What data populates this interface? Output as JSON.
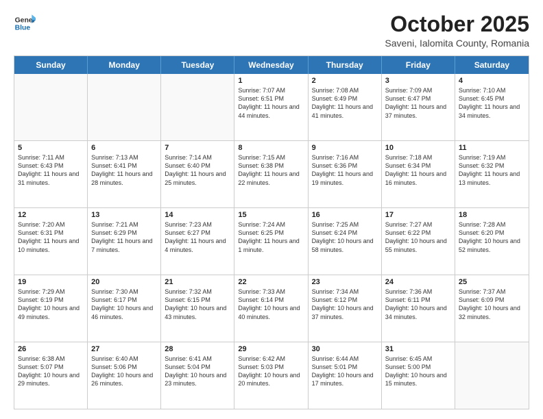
{
  "header": {
    "logo_line1": "General",
    "logo_line2": "Blue",
    "title": "October 2025",
    "subtitle": "Saveni, Ialomita County, Romania"
  },
  "calendar": {
    "days_of_week": [
      "Sunday",
      "Monday",
      "Tuesday",
      "Wednesday",
      "Thursday",
      "Friday",
      "Saturday"
    ],
    "rows": [
      [
        {
          "day": "",
          "empty": true
        },
        {
          "day": "",
          "empty": true
        },
        {
          "day": "",
          "empty": true
        },
        {
          "day": "1",
          "sunrise": "7:07 AM",
          "sunset": "6:51 PM",
          "daylight": "11 hours and 44 minutes."
        },
        {
          "day": "2",
          "sunrise": "7:08 AM",
          "sunset": "6:49 PM",
          "daylight": "11 hours and 41 minutes."
        },
        {
          "day": "3",
          "sunrise": "7:09 AM",
          "sunset": "6:47 PM",
          "daylight": "11 hours and 37 minutes."
        },
        {
          "day": "4",
          "sunrise": "7:10 AM",
          "sunset": "6:45 PM",
          "daylight": "11 hours and 34 minutes."
        }
      ],
      [
        {
          "day": "5",
          "sunrise": "7:11 AM",
          "sunset": "6:43 PM",
          "daylight": "11 hours and 31 minutes."
        },
        {
          "day": "6",
          "sunrise": "7:13 AM",
          "sunset": "6:41 PM",
          "daylight": "11 hours and 28 minutes."
        },
        {
          "day": "7",
          "sunrise": "7:14 AM",
          "sunset": "6:40 PM",
          "daylight": "11 hours and 25 minutes."
        },
        {
          "day": "8",
          "sunrise": "7:15 AM",
          "sunset": "6:38 PM",
          "daylight": "11 hours and 22 minutes."
        },
        {
          "day": "9",
          "sunrise": "7:16 AM",
          "sunset": "6:36 PM",
          "daylight": "11 hours and 19 minutes."
        },
        {
          "day": "10",
          "sunrise": "7:18 AM",
          "sunset": "6:34 PM",
          "daylight": "11 hours and 16 minutes."
        },
        {
          "day": "11",
          "sunrise": "7:19 AM",
          "sunset": "6:32 PM",
          "daylight": "11 hours and 13 minutes."
        }
      ],
      [
        {
          "day": "12",
          "sunrise": "7:20 AM",
          "sunset": "6:31 PM",
          "daylight": "11 hours and 10 minutes."
        },
        {
          "day": "13",
          "sunrise": "7:21 AM",
          "sunset": "6:29 PM",
          "daylight": "11 hours and 7 minutes."
        },
        {
          "day": "14",
          "sunrise": "7:23 AM",
          "sunset": "6:27 PM",
          "daylight": "11 hours and 4 minutes."
        },
        {
          "day": "15",
          "sunrise": "7:24 AM",
          "sunset": "6:25 PM",
          "daylight": "11 hours and 1 minute."
        },
        {
          "day": "16",
          "sunrise": "7:25 AM",
          "sunset": "6:24 PM",
          "daylight": "10 hours and 58 minutes."
        },
        {
          "day": "17",
          "sunrise": "7:27 AM",
          "sunset": "6:22 PM",
          "daylight": "10 hours and 55 minutes."
        },
        {
          "day": "18",
          "sunrise": "7:28 AM",
          "sunset": "6:20 PM",
          "daylight": "10 hours and 52 minutes."
        }
      ],
      [
        {
          "day": "19",
          "sunrise": "7:29 AM",
          "sunset": "6:19 PM",
          "daylight": "10 hours and 49 minutes."
        },
        {
          "day": "20",
          "sunrise": "7:30 AM",
          "sunset": "6:17 PM",
          "daylight": "10 hours and 46 minutes."
        },
        {
          "day": "21",
          "sunrise": "7:32 AM",
          "sunset": "6:15 PM",
          "daylight": "10 hours and 43 minutes."
        },
        {
          "day": "22",
          "sunrise": "7:33 AM",
          "sunset": "6:14 PM",
          "daylight": "10 hours and 40 minutes."
        },
        {
          "day": "23",
          "sunrise": "7:34 AM",
          "sunset": "6:12 PM",
          "daylight": "10 hours and 37 minutes."
        },
        {
          "day": "24",
          "sunrise": "7:36 AM",
          "sunset": "6:11 PM",
          "daylight": "10 hours and 34 minutes."
        },
        {
          "day": "25",
          "sunrise": "7:37 AM",
          "sunset": "6:09 PM",
          "daylight": "10 hours and 32 minutes."
        }
      ],
      [
        {
          "day": "26",
          "sunrise": "6:38 AM",
          "sunset": "5:07 PM",
          "daylight": "10 hours and 29 minutes."
        },
        {
          "day": "27",
          "sunrise": "6:40 AM",
          "sunset": "5:06 PM",
          "daylight": "10 hours and 26 minutes."
        },
        {
          "day": "28",
          "sunrise": "6:41 AM",
          "sunset": "5:04 PM",
          "daylight": "10 hours and 23 minutes."
        },
        {
          "day": "29",
          "sunrise": "6:42 AM",
          "sunset": "5:03 PM",
          "daylight": "10 hours and 20 minutes."
        },
        {
          "day": "30",
          "sunrise": "6:44 AM",
          "sunset": "5:01 PM",
          "daylight": "10 hours and 17 minutes."
        },
        {
          "day": "31",
          "sunrise": "6:45 AM",
          "sunset": "5:00 PM",
          "daylight": "10 hours and 15 minutes."
        },
        {
          "day": "",
          "empty": true
        }
      ]
    ]
  }
}
